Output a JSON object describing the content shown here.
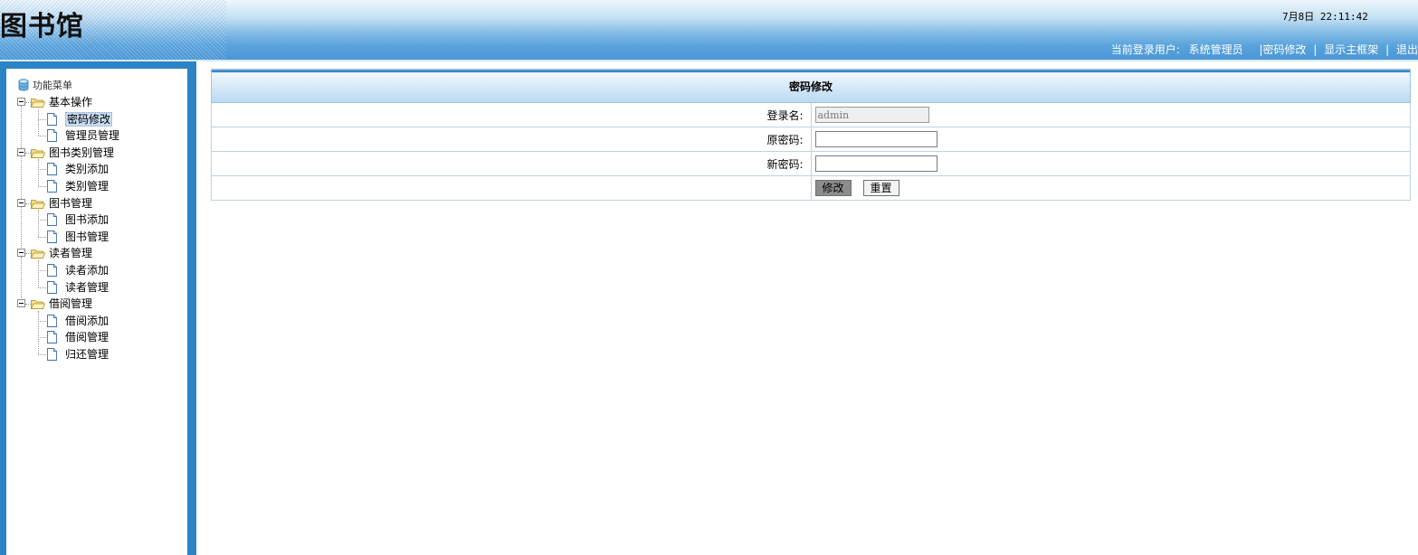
{
  "header": {
    "logo_text": "图书馆",
    "datetime": "7月8日 22:11:42",
    "user_label": "当前登录用户:",
    "user_name": "系统管理员",
    "links": [
      "|密码修改",
      "显示主框架",
      "退出"
    ],
    "separator": "|"
  },
  "sidebar": {
    "root_label": "功能菜单",
    "groups": [
      {
        "label": "基本操作",
        "items": [
          "密码修改",
          "管理员管理"
        ]
      },
      {
        "label": "图书类别管理",
        "items": [
          "类别添加",
          "类别管理"
        ]
      },
      {
        "label": "图书管理",
        "items": [
          "图书添加",
          "图书管理"
        ]
      },
      {
        "label": "读者管理",
        "items": [
          "读者添加",
          "读者管理"
        ]
      },
      {
        "label": "借阅管理",
        "items": [
          "借阅添加",
          "借阅管理",
          "归还管理"
        ]
      }
    ],
    "selected_item": "密码修改"
  },
  "form": {
    "title": "密码修改",
    "login_label": "登录名:",
    "login_value": "admin",
    "old_password_label": "原密码:",
    "old_password_value": "",
    "new_password_label": "新密码:",
    "new_password_value": "",
    "submit_label": "修改",
    "reset_label": "重置"
  }
}
